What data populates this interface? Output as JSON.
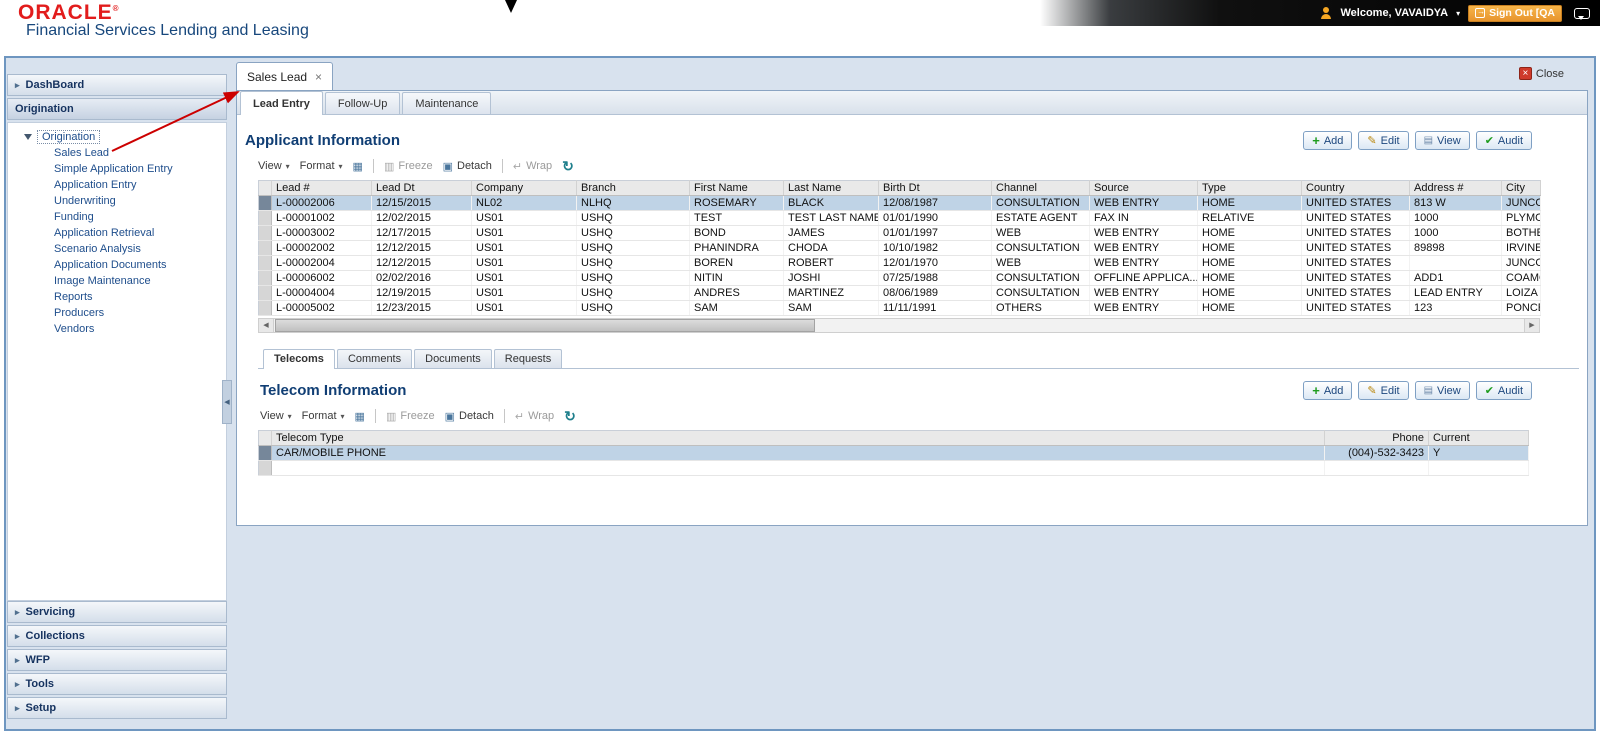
{
  "header": {
    "logo": "ORACLE",
    "subtitle": "Financial Services Lending and Leasing",
    "welcome": "Welcome, VAVAIDYA",
    "sign_out": "Sign Out [QA"
  },
  "sidebar": {
    "dashboard": "DashBoard",
    "origination": "Origination",
    "tree_root": "Origination",
    "tree_items": [
      "Sales Lead",
      "Simple Application Entry",
      "Application Entry",
      "Underwriting",
      "Funding",
      "Application Retrieval",
      "Scenario Analysis",
      "Application Documents",
      "Image Maintenance",
      "Reports",
      "Producers",
      "Vendors"
    ],
    "collapsed_sections": [
      "Servicing",
      "Collections",
      "WFP",
      "Tools",
      "Setup"
    ]
  },
  "workspace": {
    "doc_tab": "Sales Lead",
    "close_label": "Close",
    "tabs": [
      "Lead Entry",
      "Follow-Up",
      "Maintenance"
    ]
  },
  "toolbar": {
    "view": "View",
    "format": "Format",
    "freeze": "Freeze",
    "detach": "Detach",
    "wrap": "Wrap"
  },
  "actions": {
    "add": "Add",
    "edit": "Edit",
    "view": "View",
    "audit": "Audit"
  },
  "applicant": {
    "title": "Applicant Information",
    "columns": [
      "Lead #",
      "Lead Dt",
      "Company",
      "Branch",
      "First Name",
      "Last Name",
      "Birth Dt",
      "Channel",
      "Source",
      "Type",
      "Country",
      "Address #",
      "City"
    ],
    "rows": [
      [
        "L-00002006",
        "12/15/2015",
        "NL02",
        "NLHQ",
        "ROSEMARY",
        "BLACK",
        "12/08/1987",
        "CONSULTATION",
        "WEB ENTRY",
        "HOME",
        "UNITED STATES",
        "813 W",
        "JUNCOS"
      ],
      [
        "L-00001002",
        "12/02/2015",
        "US01",
        "USHQ",
        "TEST",
        "TEST LAST NAME",
        "01/01/1990",
        "ESTATE AGENT",
        "FAX IN",
        "RELATIVE",
        "UNITED STATES",
        "1000",
        "PLYMOU"
      ],
      [
        "L-00003002",
        "12/17/2015",
        "US01",
        "USHQ",
        "BOND",
        "JAMES",
        "01/01/1997",
        "WEB",
        "WEB ENTRY",
        "HOME",
        "UNITED STATES",
        "1000",
        "BOTHELL"
      ],
      [
        "L-00002002",
        "12/12/2015",
        "US01",
        "USHQ",
        "PHANINDRA",
        "CHODA",
        "10/10/1982",
        "CONSULTATION",
        "WEB ENTRY",
        "HOME",
        "UNITED STATES",
        "89898",
        "IRVINE"
      ],
      [
        "L-00002004",
        "12/12/2015",
        "US01",
        "USHQ",
        "BOREN",
        "ROBERT",
        "12/01/1970",
        "WEB",
        "WEB ENTRY",
        "HOME",
        "UNITED STATES",
        "",
        "JUNCOS"
      ],
      [
        "L-00006002",
        "02/02/2016",
        "US01",
        "USHQ",
        "NITIN",
        "JOSHI",
        "07/25/1988",
        "CONSULTATION",
        "OFFLINE APPLICA...",
        "HOME",
        "UNITED STATES",
        "ADD1",
        "COAMO"
      ],
      [
        "L-00004004",
        "12/19/2015",
        "US01",
        "USHQ",
        "ANDRES",
        "MARTINEZ",
        "08/06/1989",
        "CONSULTATION",
        "WEB ENTRY",
        "HOME",
        "UNITED STATES",
        "LEAD ENTRY",
        "LOIZA"
      ],
      [
        "L-00005002",
        "12/23/2015",
        "US01",
        "USHQ",
        "SAM",
        "SAM",
        "11/11/1991",
        "OTHERS",
        "WEB ENTRY",
        "HOME",
        "UNITED STATES",
        "123",
        "PONCE"
      ]
    ],
    "selected_row": 0,
    "empty_rows": 0
  },
  "detail": {
    "tabs": [
      "Telecoms",
      "Comments",
      "Documents",
      "Requests"
    ],
    "title": "Telecom Information",
    "columns": [
      "Telecom Type",
      "Phone",
      "Current"
    ],
    "rows": [
      [
        "CAR/MOBILE PHONE",
        "(004)-532-3423",
        "Y"
      ]
    ],
    "selected_row": 0,
    "empty_rows": 1
  },
  "colors": {
    "accent_red": "#cc0000",
    "logo_red": "#e21c1c",
    "title_blue": "#103e74",
    "selected_row": "#bfd3e6",
    "signout_orange": "#e8952d"
  }
}
